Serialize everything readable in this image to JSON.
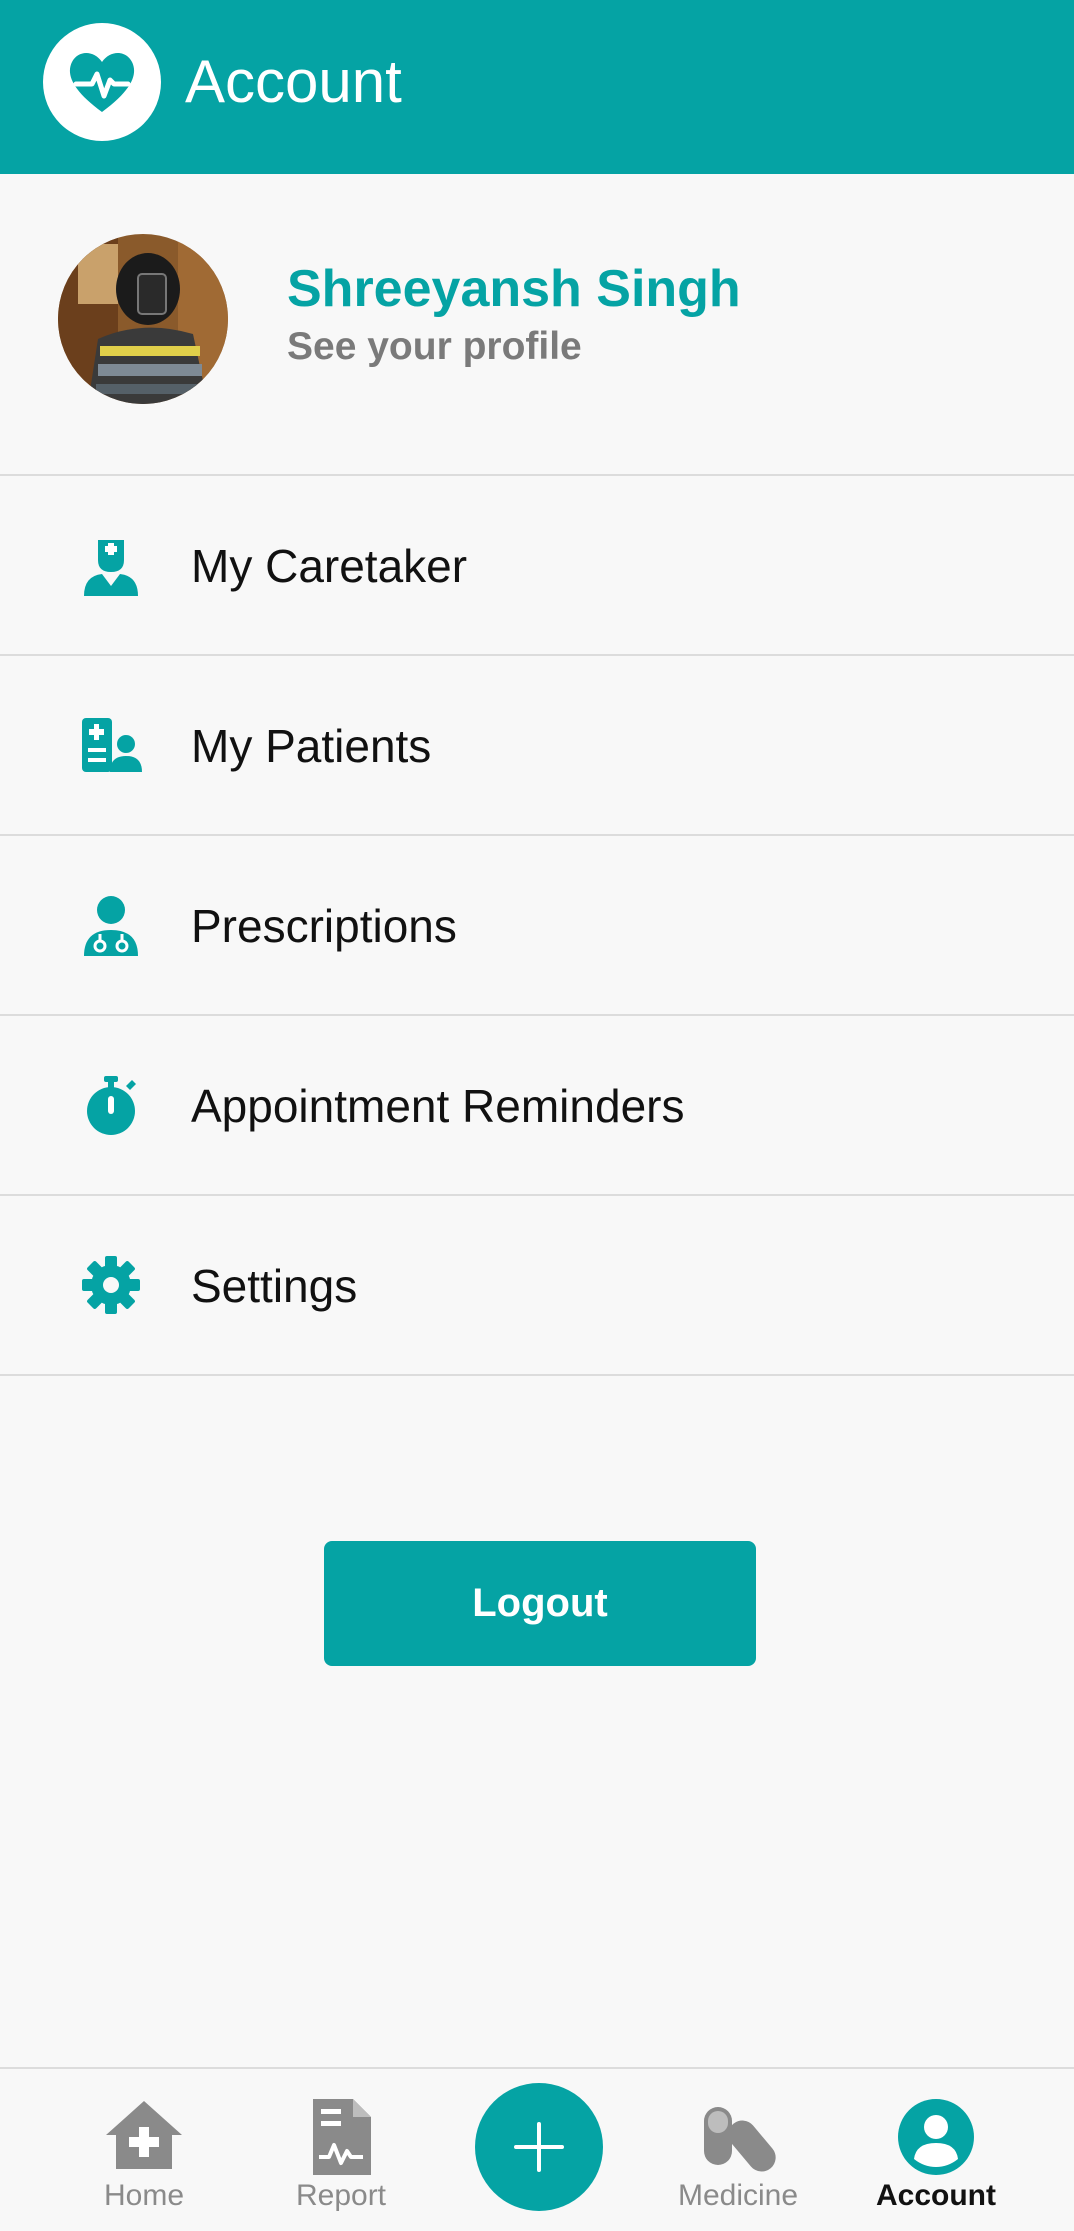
{
  "app_bar": {
    "title": "Account",
    "logo_icon": "heart-pulse-icon"
  },
  "profile": {
    "name": "Shreeyansh Singh",
    "subtitle": "See your profile"
  },
  "menu": [
    {
      "label": "My Caretaker",
      "icon": "nurse-icon"
    },
    {
      "label": "My Patients",
      "icon": "patients-icon"
    },
    {
      "label": "Prescriptions",
      "icon": "doctor-icon"
    },
    {
      "label": "Appointment Reminders",
      "icon": "stopwatch-icon"
    },
    {
      "label": "Settings",
      "icon": "gear-icon"
    }
  ],
  "logout_label": "Logout",
  "bottom_nav": {
    "items": [
      {
        "label": "Home",
        "icon": "home-medical-icon"
      },
      {
        "label": "Report",
        "icon": "report-icon"
      },
      {
        "label": "Medicine",
        "icon": "pills-icon"
      },
      {
        "label": "Account",
        "icon": "account-icon"
      }
    ],
    "add_icon": "plus-icon",
    "active": "Account"
  },
  "colors": {
    "accent": "#05a3a4",
    "background": "#f8f8f8",
    "inactive": "#8a8a8a"
  }
}
